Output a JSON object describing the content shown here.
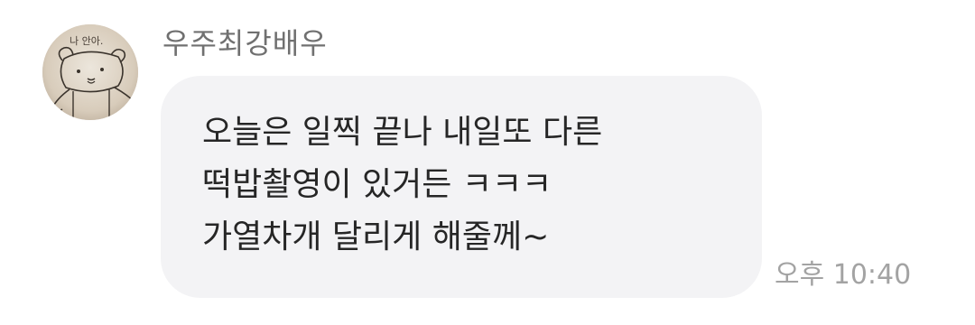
{
  "message": {
    "sender_name": "우주최강배우",
    "avatar_icon": "hand-drawn-bear-avatar",
    "avatar_scribble_text": "나 안아.",
    "lines": [
      "오늘은 일찍 끝나 내일또 다른",
      "떡밥촬영이 있거든 ㅋㅋㅋ",
      "가열차개 달리게 해줄께~"
    ],
    "timestamp": "오후 10:40"
  },
  "colors": {
    "bubble_background": "#f3f3f5",
    "message_text": "#262626",
    "sender_name_text": "#707070",
    "timestamp_text": "#a3a3a3"
  }
}
